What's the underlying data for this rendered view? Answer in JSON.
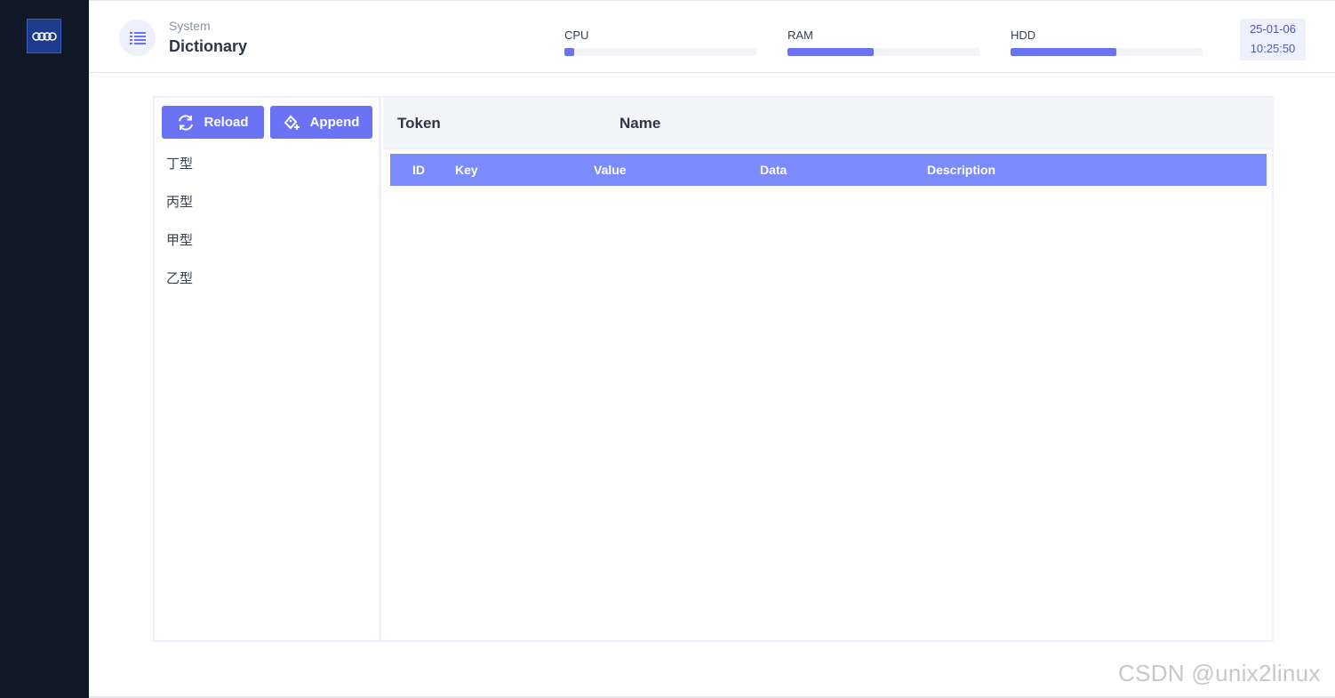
{
  "header": {
    "section": "System",
    "title": "Dictionary",
    "meters": [
      {
        "label": "CPU",
        "fraction": 0.05
      },
      {
        "label": "RAM",
        "fraction": 0.45
      },
      {
        "label": "HDD",
        "fraction": 0.55
      }
    ],
    "date": "25-01-06",
    "time": "10:25:50"
  },
  "toolbar": {
    "reload_label": "Reload",
    "append_label": "Append"
  },
  "list": {
    "items": [
      "丁型",
      "丙型",
      "甲型",
      "乙型"
    ]
  },
  "filter": {
    "token_label": "Token",
    "name_label": "Name"
  },
  "table": {
    "columns": [
      "ID",
      "Key",
      "Value",
      "Data",
      "Description"
    ]
  },
  "watermark": "CSDN @unix2linux",
  "colors": {
    "accent": "#6b73f5",
    "table_header": "#7b8bfb",
    "sidebar": "#111827"
  }
}
